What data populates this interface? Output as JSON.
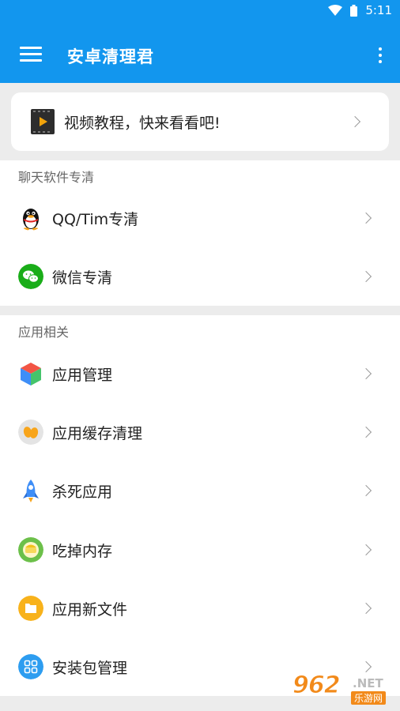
{
  "status_bar": {
    "time": "5:11",
    "icons": [
      "wifi-icon",
      "battery-icon"
    ]
  },
  "app_bar": {
    "title": "安卓清理君",
    "menu_icon": "hamburger-menu-icon",
    "overflow_icon": "more-vert-icon",
    "color": "#1296ee"
  },
  "video_card": {
    "label": "视频教程，快来看看吧!",
    "icon": "video-play-icon"
  },
  "sections": [
    {
      "title": "聊天软件专清",
      "items": [
        {
          "label": "QQ/Tim专清",
          "icon": "qq-penguin-icon"
        },
        {
          "label": "微信专清",
          "icon": "wechat-icon"
        }
      ]
    },
    {
      "title": "应用相关",
      "items": [
        {
          "label": "应用管理",
          "icon": "app-cube-icon"
        },
        {
          "label": "应用缓存清理",
          "icon": "cache-clean-icon"
        },
        {
          "label": "杀死应用",
          "icon": "rocket-icon"
        },
        {
          "label": "吃掉内存",
          "icon": "memory-eat-icon"
        },
        {
          "label": "应用新文件",
          "icon": "folder-icon"
        },
        {
          "label": "安装包管理",
          "icon": "apk-grid-icon"
        }
      ]
    }
  ],
  "watermark": {
    "number": "962",
    "domain": ".NET",
    "name": "乐游网"
  }
}
